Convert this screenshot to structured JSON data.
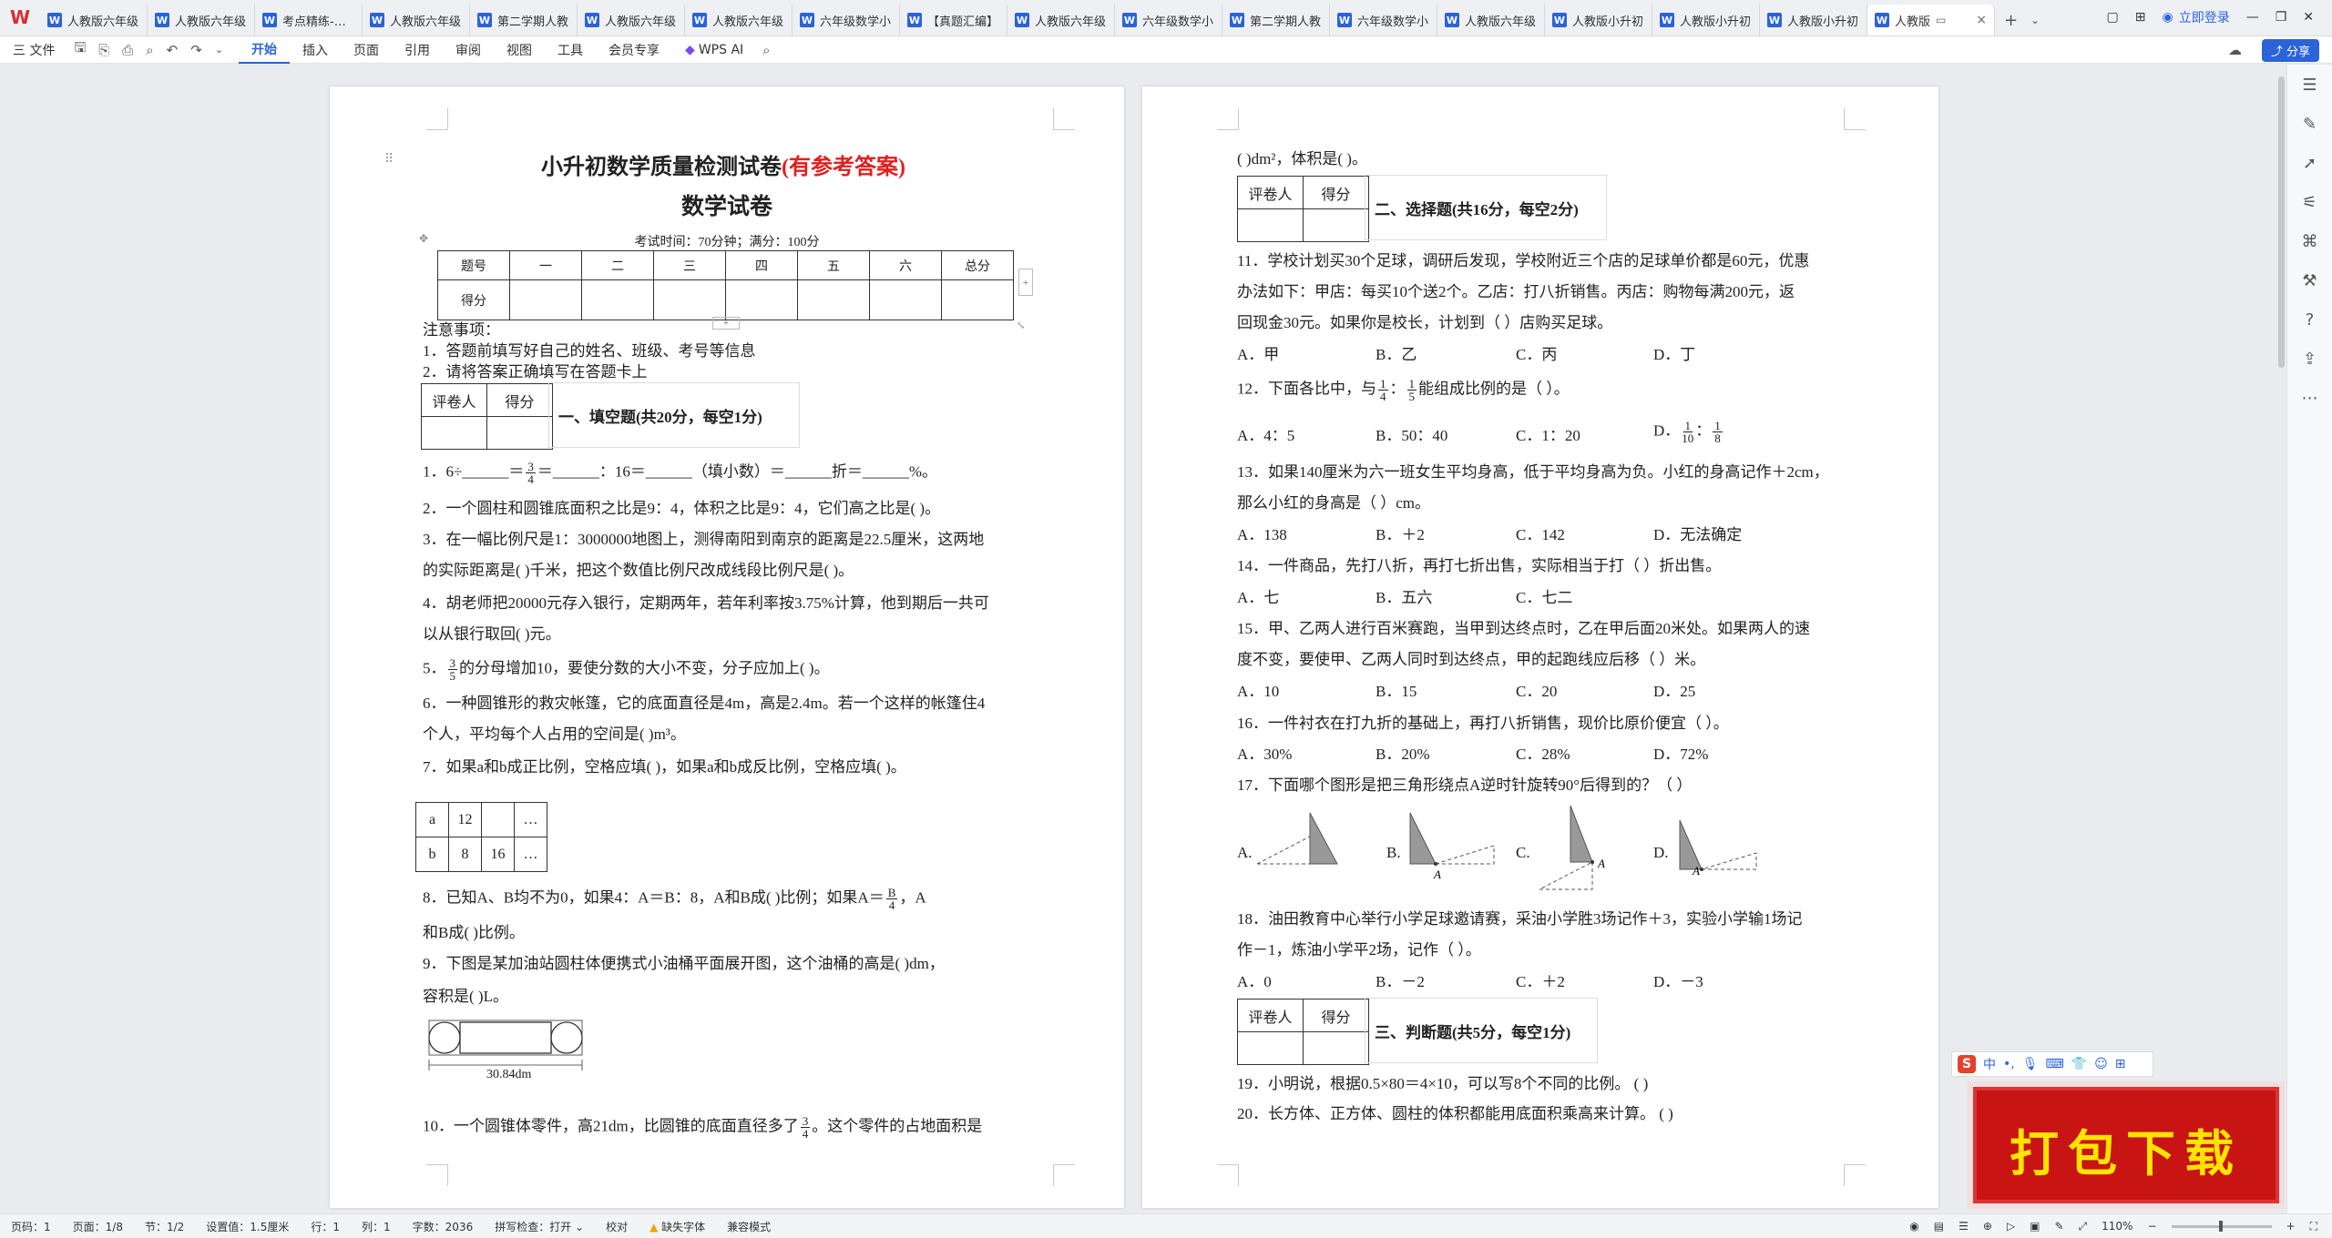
{
  "app": {
    "logo": "W"
  },
  "tabs": [
    {
      "label": "人教版六年级"
    },
    {
      "label": "人教版六年级"
    },
    {
      "label": "考点精练-人教"
    },
    {
      "label": "人教版六年级"
    },
    {
      "label": "第二学期人教"
    },
    {
      "label": "人教版六年级"
    },
    {
      "label": "人教版六年级"
    },
    {
      "label": "六年级数学小"
    },
    {
      "label": "【真题汇编】"
    },
    {
      "label": "人教版六年级"
    },
    {
      "label": "六年级数学小"
    },
    {
      "label": "第二学期人教"
    },
    {
      "label": "六年级数学小"
    },
    {
      "label": "人教版六年级"
    },
    {
      "label": "人教版小升初"
    },
    {
      "label": "人教版小升初"
    },
    {
      "label": "人教版小升初"
    }
  ],
  "active_tab": {
    "label": "人教版"
  },
  "login": {
    "label": "立即登录"
  },
  "menu": {
    "file": "三 文件",
    "items": [
      "开始",
      "插入",
      "页面",
      "引用",
      "审阅",
      "视图",
      "工具",
      "会员专享"
    ],
    "wps_ai": "WPS AI",
    "share": "分享"
  },
  "page1": {
    "title": "小升初数学质量检测试卷",
    "title_red": "(有参考答案)",
    "subtitle": "数学试卷",
    "exam_info": "考试时间：70分钟；满分：100分",
    "score_table": {
      "header": [
        "题号",
        "一",
        "二",
        "三",
        "四",
        "五",
        "六",
        "总分"
      ],
      "row_label": "得分"
    },
    "notes_title": "注意事项：",
    "notes": [
      "1．答题前填写好自己的姓名、班级、考号等信息",
      "2．请将答案正确填写在答题卡上"
    ],
    "grader": {
      "a": "评卷人",
      "b": "得分"
    },
    "section1": "一、填空题(共20分，每空1分)",
    "q1_a": "1．6÷______＝",
    "q1_frac_n": "3",
    "q1_frac_d": "4",
    "q1_b": "＝______：16＝______（填小数）＝______折＝______%。",
    "q2": "2．一个圆柱和圆锥底面积之比是9：4，体积之比是9：4，它们高之比是(          )。",
    "q3_a": "3．在一幅比例尺是1：3000000地图上，测得南阳到南京的距离是22.5厘米，这两地",
    "q3_b": "的实际距离是(          )千米，把这个数值比例尺改成线段比例尺是(          )。",
    "q4_a": "4．胡老师把20000元存入银行，定期两年，若年利率按3.75%计算，他到期后一共可",
    "q4_b": "以从银行取回(            )元。",
    "q5_frac_n": "3",
    "q5_frac_d": "5",
    "q5_a": "5．",
    "q5_b": "的分母增加10，要使分数的大小不变，分子应加上(            )。",
    "q6_a": "6．一种圆锥形的救灾帐篷，它的底面直径是4m，高是2.4m。若一个这样的帐篷住4",
    "q6_b": "个人，平均每个人占用的空间是(            )m³。",
    "q7": "7．如果a和b成正比例，空格应填(        )，如果a和b成反比例，空格应填(        )。",
    "ratio_table": [
      [
        "a",
        "12",
        "",
        "…"
      ],
      [
        "b",
        "8",
        "16",
        "…"
      ]
    ],
    "q8_a": "8．已知A、B均不为0，如果4：A＝B：8，A和B成(            )比例；如果A＝",
    "q8_frac_n": "B",
    "q8_frac_d": "4",
    "q8_c": "，A",
    "q8_b": "和B成(            )比例。",
    "q9_a": "9．下图是某加油站圆柱体便携式小油桶平面展开图，这个油桶的高是(            )dm，",
    "q9_b": "容积是(            )L。",
    "q9_label": "30.84dm",
    "q10_a": "10．一个圆锥体零件，高21dm，比圆锥的底面直径多了",
    "q10_frac_n": "3",
    "q10_frac_d": "4",
    "q10_b": "。这个零件的占地面积是"
  },
  "page2": {
    "top_line": "(          )dm²，体积是(          )。",
    "grader": {
      "a": "评卷人",
      "b": "得分"
    },
    "section2": "二、选择题(共16分，每空2分)",
    "q11_a": "11．学校计划买30个足球，调研后发现，学校附近三个店的足球单价都是60元，优惠",
    "q11_b": "办法如下：甲店：每买10个送2个。乙店：打八折销售。丙店：购物每满200元，返",
    "q11_c": "回现金30元。如果你是校长，计划到（    ）店购买足球。",
    "q11_opts": [
      "A．甲",
      "B．乙",
      "C．丙",
      "D．丁"
    ],
    "q12_a": "12．下面各比中，与",
    "q12_f1n": "1",
    "q12_f1d": "4",
    "q12_sep": "：",
    "q12_f2n": "1",
    "q12_f2d": "5",
    "q12_b": "能组成比例的是（    ）。",
    "q12_opts": [
      "A．4：5",
      "B．50：40",
      "C．1：20",
      "D．"
    ],
    "q12_d_f1n": "1",
    "q12_d_f1d": "10",
    "q12_d_f2n": "1",
    "q12_d_f2d": "8",
    "q13_a": "13．如果140厘米为六一班女生平均身高，低于平均身高为负。小红的身高记作＋2cm，",
    "q13_b": "那么小红的身高是（    ）cm。",
    "q13_opts": [
      "A．138",
      "B．＋2",
      "C．142",
      "D．无法确定"
    ],
    "q14": "14．一件商品，先打八折，再打七折出售，实际相当于打（    ）折出售。",
    "q14_opts": [
      "A．七",
      "B．五六",
      "C．七二"
    ],
    "q15_a": "15．甲、乙两人进行百米赛跑，当甲到达终点时，乙在甲后面20米处。如果两人的速",
    "q15_b": "度不变，要使甲、乙两人同时到达终点，甲的起跑线应后移（    ）米。",
    "q15_opts": [
      "A．10",
      "B．15",
      "C．20",
      "D．25"
    ],
    "q16": "16．一件衬衣在打九折的基础上，再打八折销售，现价比原价便宜（    ）。",
    "q16_opts": [
      "A．30%",
      "B．20%",
      "C．28%",
      "D．72%"
    ],
    "q17": "17．下面哪个图形是把三角形绕点A逆时针旋转90°后得到的？（    ）",
    "q17_opts": [
      "A.",
      "B.",
      "C.",
      "D."
    ],
    "q17_point": "A",
    "q18_a": "18．油田教育中心举行小学足球邀请赛，采油小学胜3场记作＋3，实验小学输1场记",
    "q18_b": "作－1，炼油小学平2场，记作（    ）。",
    "q18_opts": [
      "A．0",
      "B．－2",
      "C．＋2",
      "D．－3"
    ],
    "section3": "三、判断题(共5分，每空1分)",
    "q19": "19．小明说，根据0.5×80＝4×10，可以写8个不同的比例。          (          )",
    "q20": "20．长方体、正方体、圆柱的体积都能用底面积乘高来计算。          (          )"
  },
  "overlay": {
    "ime": "中",
    "download": "打包下载"
  },
  "status": {
    "page": "页码：1",
    "pages": "页面：1/8",
    "section": "节：1/2",
    "setting": "设置值：1.5厘米",
    "row": "行：1",
    "col": "列：1",
    "words": "字数：2036",
    "spell": "拼写检查：打开 ⌄",
    "proof": "校对",
    "missing_font": "缺失字体",
    "compat": "兼容模式",
    "zoom": "110%"
  },
  "colors": {
    "accent": "#2b63d9",
    "red_title": "#e02020",
    "download_bg": "#c91414",
    "download_text": "#ffe400"
  }
}
